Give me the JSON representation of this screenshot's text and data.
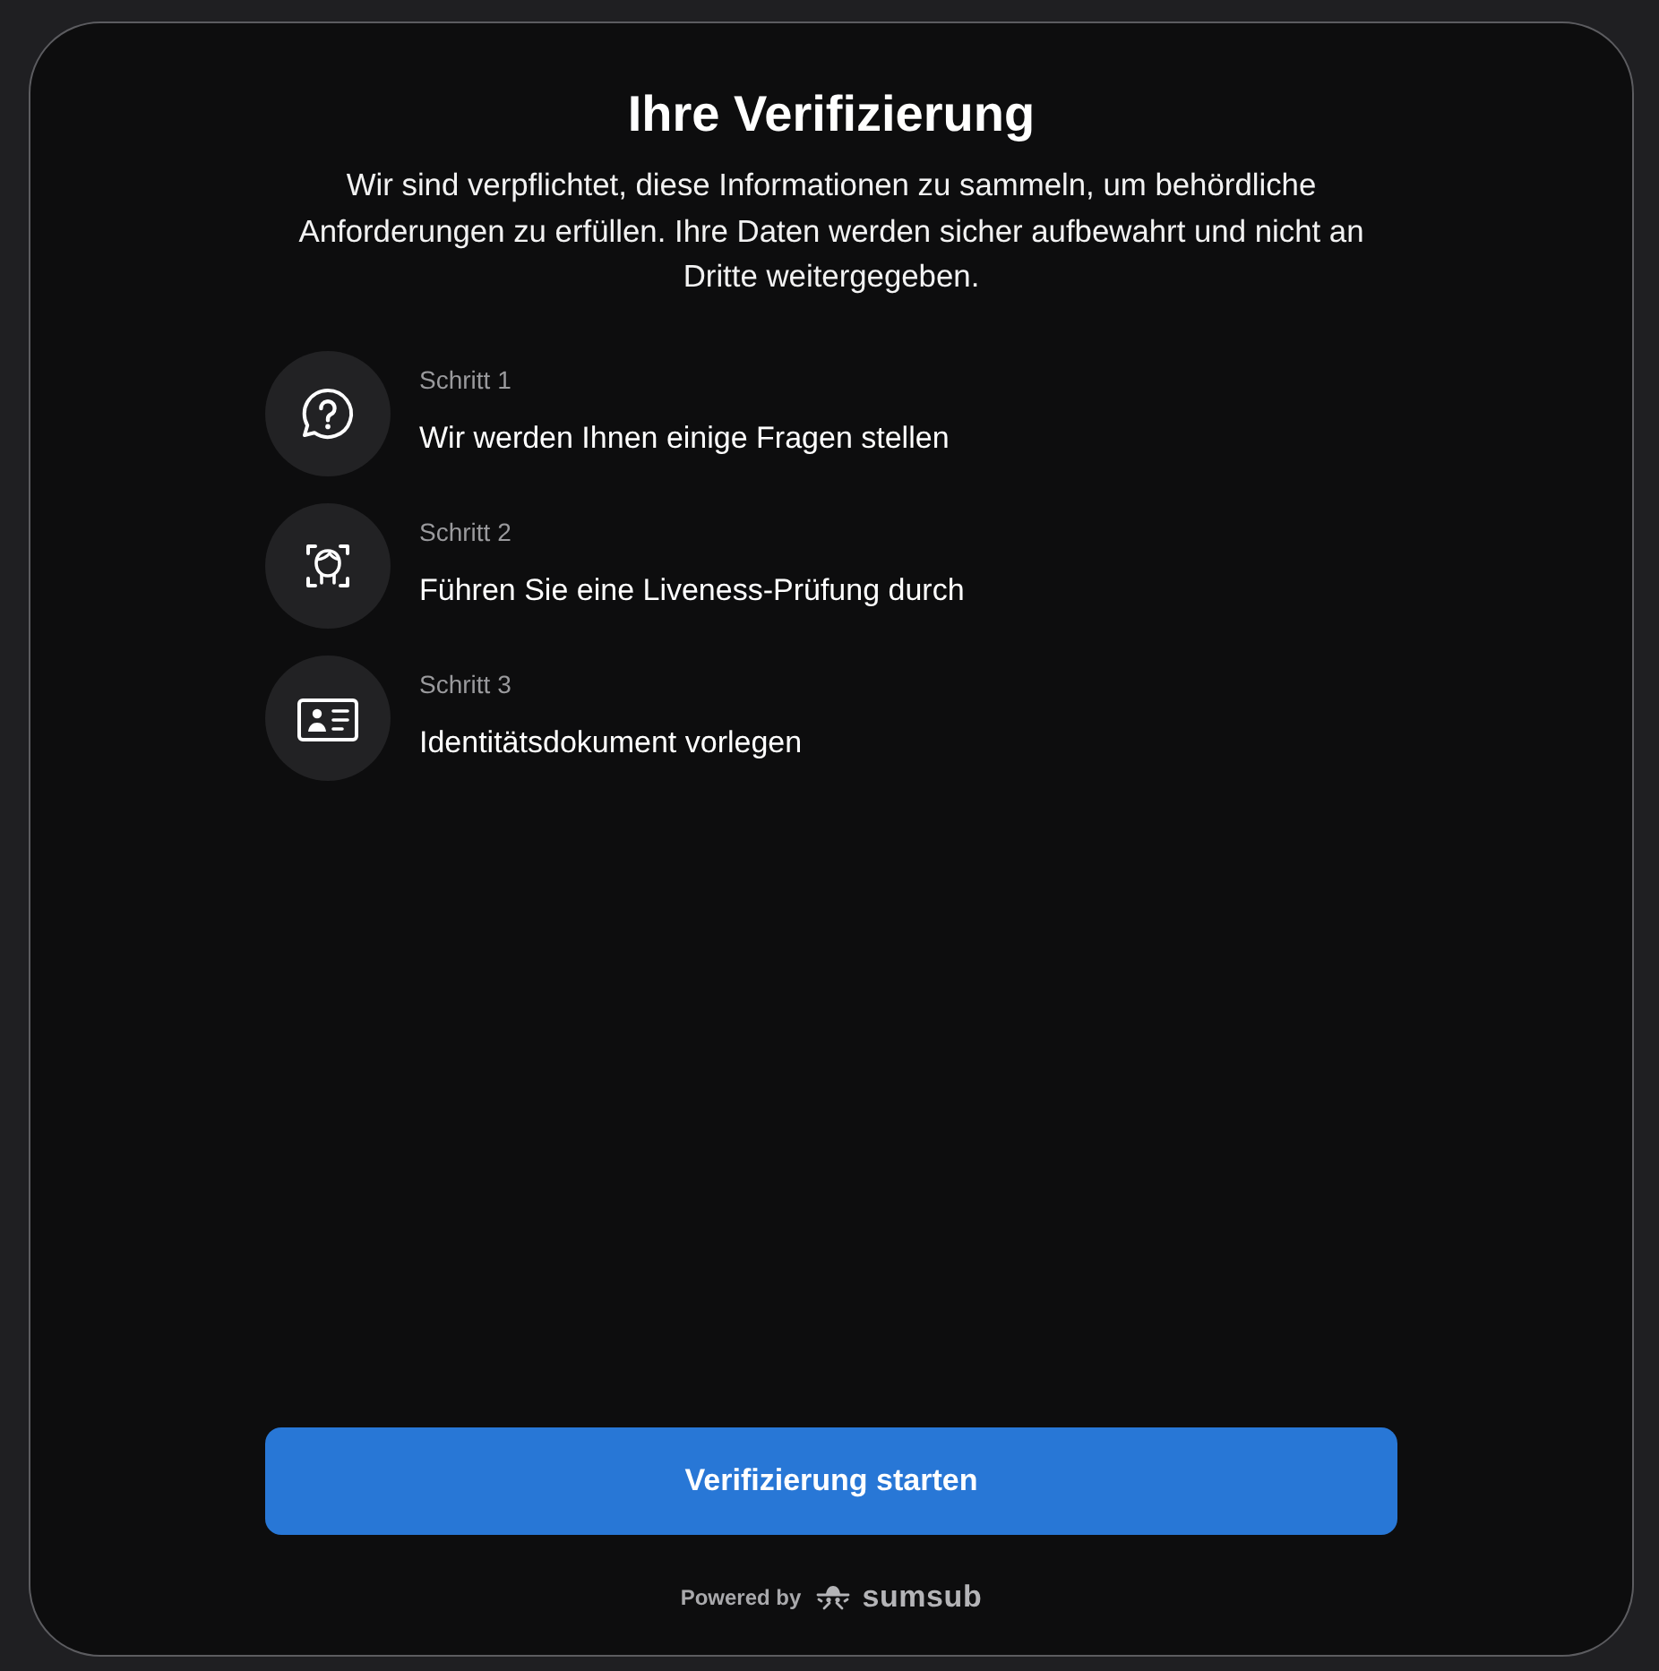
{
  "title": "Ihre Verifizierung",
  "description": "Wir sind verpflichtet, diese Informationen zu sammeln, um behördliche Anforderungen zu erfüllen. Ihre Daten werden sicher aufbewahrt und nicht an Dritte weitergegeben.",
  "steps": [
    {
      "kind": "question",
      "label": "Schritt 1",
      "text": "Wir werden Ihnen einige Fragen stellen"
    },
    {
      "kind": "face",
      "label": "Schritt 2",
      "text": "Führen Sie eine Liveness-Prüfung durch"
    },
    {
      "kind": "document",
      "label": "Schritt 3",
      "text": "Identitätsdokument vorlegen"
    }
  ],
  "button": {
    "label": "Verifizierung starten"
  },
  "footer": {
    "powered_by": "Powered by",
    "brand": "sumsub"
  }
}
